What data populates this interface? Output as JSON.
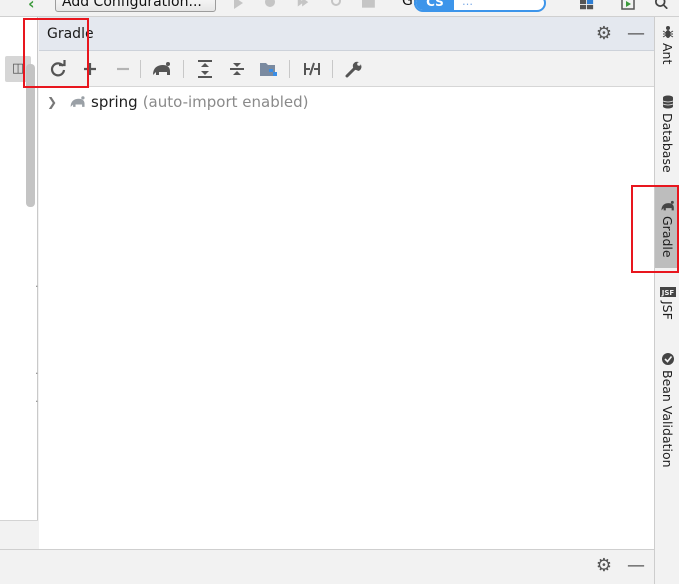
{
  "topbar": {
    "run_config_label": "Add Configuration...",
    "git_label": "Gi",
    "ext_badge_left": "CS",
    "ext_badge_right": "…",
    "icons": [
      "run-icon",
      "debug-icon",
      "coverage-icon",
      "profile-icon",
      "stop-icon",
      "project-structure-icon",
      "search-icon"
    ]
  },
  "tool_window": {
    "title": "Gradle",
    "header_icons": [
      "gear-icon",
      "minimize-icon"
    ],
    "toolbar": [
      {
        "name": "reimport-all-gradle-projects",
        "icon": "refresh-icon"
      },
      {
        "name": "link-gradle-project",
        "icon": "plus-icon"
      },
      {
        "name": "unlink-gradle-project",
        "icon": "minus-icon"
      },
      {
        "name": "execute-gradle-task",
        "icon": "elephant-icon"
      },
      {
        "name": "expand-all",
        "icon": "expand-all-icon"
      },
      {
        "name": "collapse-all",
        "icon": "collapse-all-icon"
      },
      {
        "name": "group-modules",
        "icon": "group-modules-icon"
      },
      {
        "name": "toggle-offline-mode",
        "icon": "offline-mode-icon"
      },
      {
        "name": "gradle-settings",
        "icon": "wrench-icon"
      }
    ],
    "tree": [
      {
        "name": "spring",
        "note": "(auto-import enabled)",
        "expanded": false
      }
    ]
  },
  "right_strip": {
    "tabs": [
      {
        "label": "Ant",
        "icon": "ant-icon",
        "active": false
      },
      {
        "label": "Database",
        "icon": "database-icon",
        "active": false
      },
      {
        "label": "Gradle",
        "icon": "elephant-icon",
        "active": true
      },
      {
        "label": "JSF",
        "icon": "jsf-icon",
        "active": false
      },
      {
        "label": "Bean Validation",
        "icon": "bean-validation-icon",
        "active": false
      }
    ]
  },
  "bottom_strip": {
    "icons": [
      "gear-icon",
      "minimize-icon"
    ]
  },
  "colors": {
    "highlight_box": "#e8161e",
    "header_bg": "#e4e8ef",
    "active_tab_bg": "#bdbdbd"
  }
}
